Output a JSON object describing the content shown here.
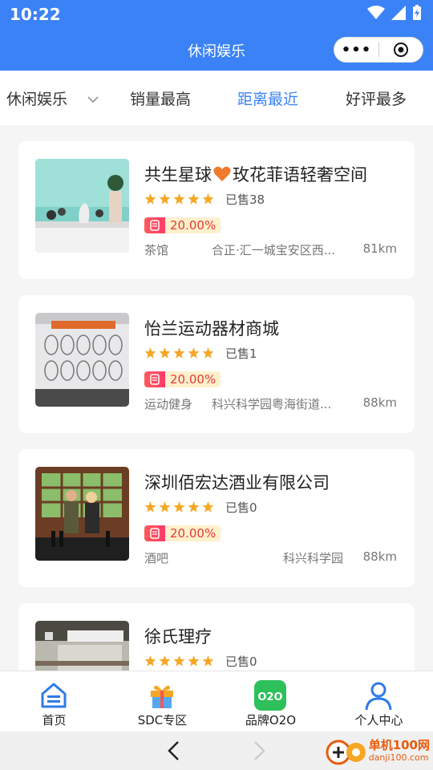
{
  "statusbar": {
    "time": "10:22"
  },
  "navbar": {
    "title": "休闲娱乐",
    "more_label": "•••"
  },
  "filters": [
    {
      "label": "休闲娱乐"
    },
    {
      "label": "销量最高"
    },
    {
      "label": "距离最近"
    },
    {
      "label": "好评最多"
    }
  ],
  "stores": [
    {
      "name": "共生星球",
      "name_suffix": "玫花菲语轻奢空间",
      "rating": 5,
      "sold": "已售38",
      "discount": "20.00%",
      "category": "茶馆",
      "address": "合正·汇一城宝安区西...",
      "distance": "81km"
    },
    {
      "name": "怡兰运动器材商城",
      "rating": 5,
      "sold": "已售1",
      "discount": "20.00%",
      "category": "运动健身",
      "address": "科兴科学园粤海街道...",
      "distance": "88km"
    },
    {
      "name": "深圳佰宏达酒业有限公司",
      "rating": 5,
      "sold": "已售0",
      "discount": "20.00%",
      "category": "酒吧",
      "address": "科兴科学园",
      "distance": "88km"
    },
    {
      "name": "徐氏理疗",
      "rating": 5,
      "sold": "已售0",
      "discount": "",
      "category": "",
      "address": "",
      "distance": ""
    }
  ],
  "tabbar": [
    {
      "label": "首页",
      "icon": "home-icon"
    },
    {
      "label": "SDC专区",
      "icon": "gift-icon"
    },
    {
      "label": "品牌O2O",
      "icon": "o2o-icon"
    },
    {
      "label": "个人中心",
      "icon": "user-icon"
    }
  ],
  "watermark": {
    "title": "单机100网",
    "url": "danji100.com"
  },
  "colors": {
    "primary": "#3b82f6",
    "star": "#f5a623",
    "badge": "#e53935"
  }
}
